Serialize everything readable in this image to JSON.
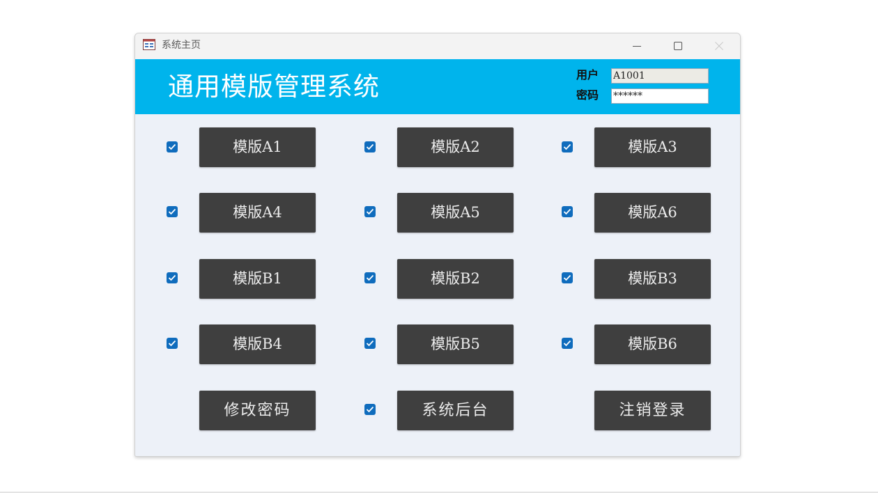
{
  "window": {
    "title": "系统主页"
  },
  "header": {
    "title": "通用模版管理系统",
    "user_label": "用户",
    "user_value": "A1001",
    "password_label": "密码",
    "password_value": "******"
  },
  "templates": {
    "a1": {
      "label": "模版A1",
      "checked": true
    },
    "a2": {
      "label": "模版A2",
      "checked": true
    },
    "a3": {
      "label": "模版A3",
      "checked": true
    },
    "a4": {
      "label": "模版A4",
      "checked": true
    },
    "a5": {
      "label": "模版A5",
      "checked": true
    },
    "a6": {
      "label": "模版A6",
      "checked": true
    },
    "b1": {
      "label": "模版B1",
      "checked": true
    },
    "b2": {
      "label": "模版B2",
      "checked": true
    },
    "b3": {
      "label": "模版B3",
      "checked": true
    },
    "b4": {
      "label": "模版B4",
      "checked": true
    },
    "b5": {
      "label": "模版B5",
      "checked": true
    },
    "b6": {
      "label": "模版B6",
      "checked": true
    }
  },
  "actions": {
    "change_password": "修改密码",
    "admin_backend": "系统后台",
    "admin_backend_checked": true,
    "logout": "注销登录"
  },
  "colors": {
    "header_bg": "#00b4ec",
    "button_bg": "#3f3f3f",
    "checkbox": "#0f6cbd",
    "body_bg": "#edf1f8"
  },
  "icons": {
    "app": "form-icon",
    "check": "check-icon",
    "minimize": "minimize-icon",
    "maximize": "maximize-icon",
    "close": "close-icon"
  }
}
